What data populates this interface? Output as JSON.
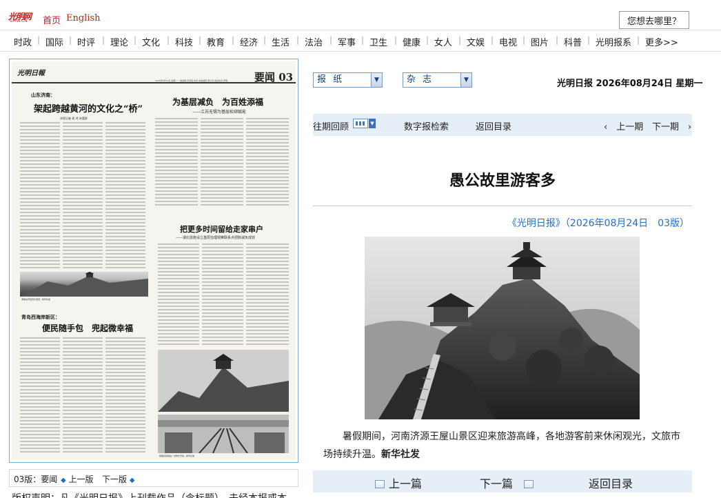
{
  "header": {
    "logo_text": "光明网",
    "logo_sub": "GMW.CN",
    "home": "首页",
    "english": "English",
    "search_prompt": "您想去哪里？"
  },
  "nav": [
    "时政",
    "国际",
    "时评",
    "理论",
    "文化",
    "科技",
    "教育",
    "经济",
    "生活",
    "法治",
    "军事",
    "卫生",
    "健康",
    "女人",
    "文娱",
    "电视",
    "图片",
    "科普",
    "光明报系",
    "更多>>"
  ],
  "paper_page": {
    "masthead": "光明日報",
    "date_line": "2026年8月24日 星期一 一版编辑 周海燕 校对 本版编辑 黄小燕 责任校对 李明",
    "section": "要闻 03",
    "kicker": "山东济南：",
    "story1_title": "架起跨越黄河的文化之“桥”",
    "story1_byline": "本报记者 高 鸿 宋喜群",
    "story2_title": "为基层减负　为百姓添福",
    "story2_subtitle": "——江苏无锡为基层松绑赋能",
    "story3_title": "把更多时间留给走家串户",
    "story3_subtitle": "——湖北恩施设立基层治理观察联系点把脉减负成效",
    "story4_kicker": "青岛西海岸新区：",
    "story4_title": "便民随手包　兜起微幸福",
    "photo_caption1": "游客在景区观光游览。新华社发",
    "photo_caption2": "铁路货运场站一派繁忙景象。新华社发"
  },
  "page_bar": {
    "label": "03版：要闻",
    "prev": "上一版",
    "next": "下一版"
  },
  "copyright": "版权声明：凡《光明日报》上刊载作品（含标题），未经本报或本",
  "selectors": {
    "newspaper": "报 纸",
    "magazine": "杂 志"
  },
  "date_line": "光明日报  2026年08月24日  星期一",
  "toolbar": {
    "back_issues": "往期回顾",
    "search": "数字报检索",
    "toc": "返回目录",
    "prev_issue": "上一期",
    "next_issue": "下一期"
  },
  "article": {
    "title": "愚公故里游客多",
    "source": "《光明日报》（2026年08月24日　03版）",
    "body_text": "暑假期间，河南济源王屋山景区迎来旅游高峰，各地游客前来休闲观光，文旅市场持续升温。",
    "body_credit": "新华社发"
  },
  "bottom_nav": {
    "prev": "上一篇",
    "next": "下一篇",
    "toc": "返回目录"
  }
}
